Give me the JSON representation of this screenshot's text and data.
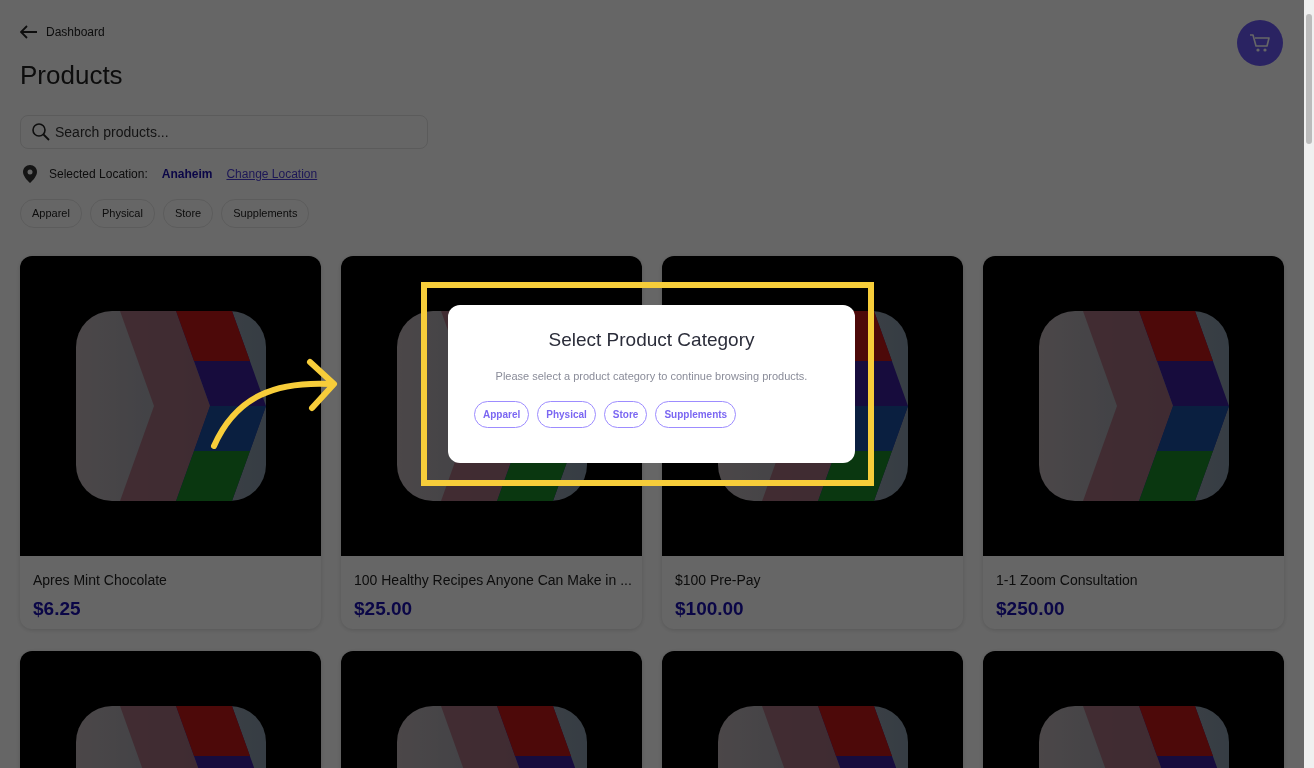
{
  "back_link": "Dashboard",
  "title": "Products",
  "search": {
    "placeholder": "Search products..."
  },
  "location": {
    "label": "Selected Location:",
    "value": "Anaheim",
    "change_link": "Change Location"
  },
  "filters": [
    "Apparel",
    "Physical",
    "Store",
    "Supplements"
  ],
  "products": [
    {
      "kind": "product",
      "name": "Apres Mint Chocolate",
      "price": "$6.25"
    },
    {
      "kind": "product",
      "name": "100 Healthy Recipes Anyone Can Make in ...",
      "price": "$25.00"
    },
    {
      "kind": "product",
      "name": "$100 Pre-Pay",
      "price": "$100.00"
    },
    {
      "kind": "product",
      "name": "1-1 Zoom Consultation",
      "price": "$250.00"
    },
    {
      "kind": "picture"
    },
    {
      "kind": "picture"
    },
    {
      "kind": "picture"
    },
    {
      "kind": "picture"
    }
  ],
  "modal": {
    "title": "Select Product Category",
    "message": "Please select a product category to continue browsing products.",
    "categories": [
      "Apparel",
      "Physical",
      "Store",
      "Supplements"
    ]
  }
}
